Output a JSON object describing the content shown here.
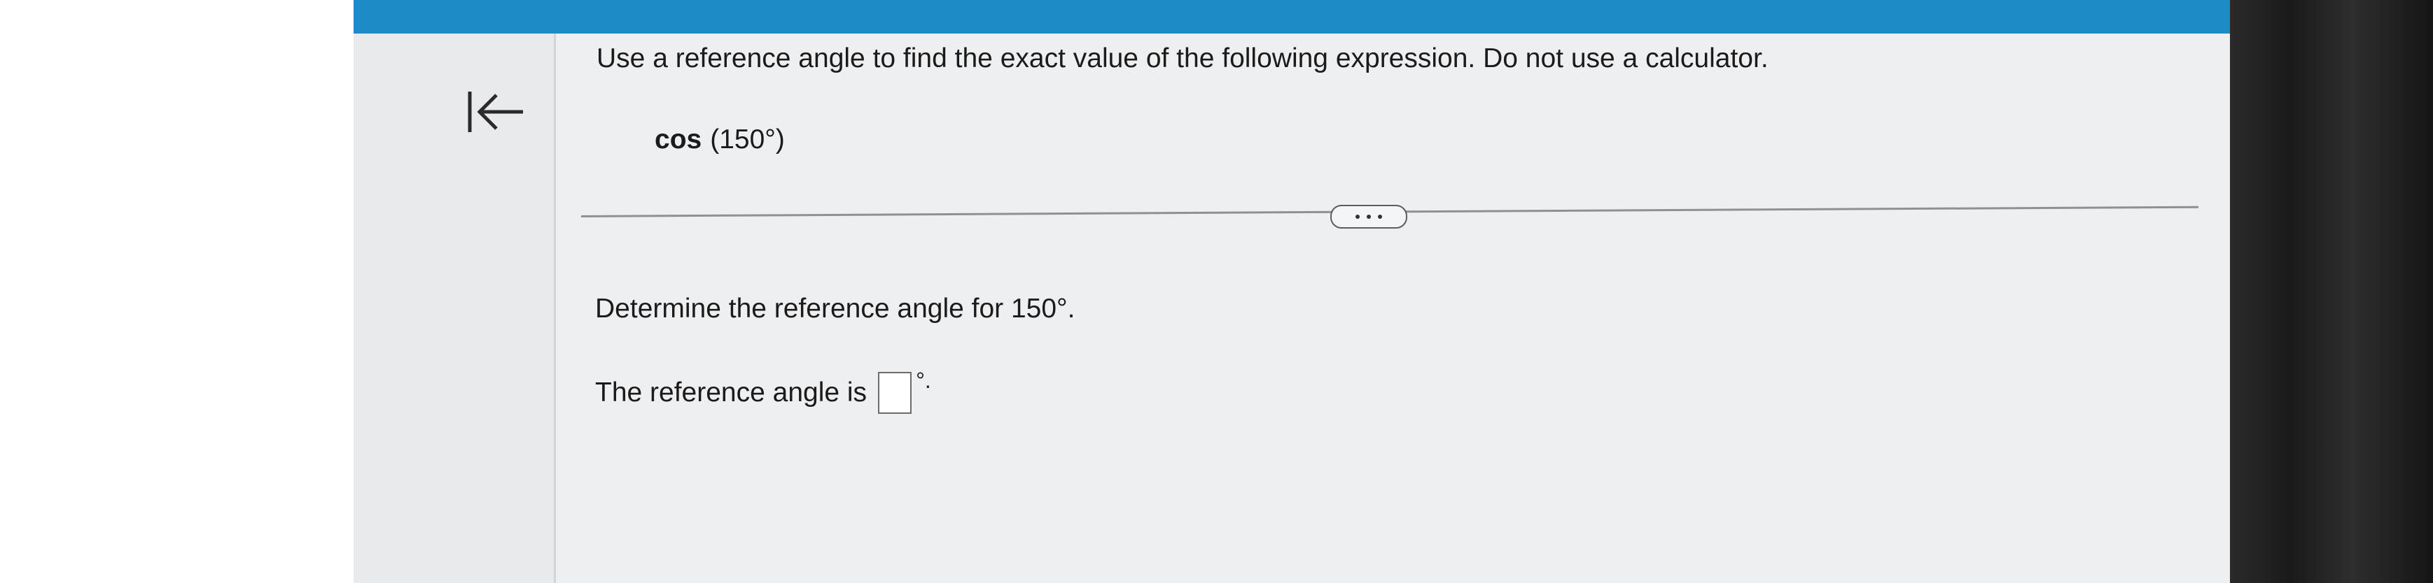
{
  "question": {
    "instruction": "Use a reference angle to find the exact value of the following expression. Do not use a calculator.",
    "expression_fn": "cos",
    "expression_arg": "(150°)"
  },
  "step": {
    "prompt": "Determine the reference angle for 150°.",
    "answer_prefix": "The reference angle is",
    "answer_suffix": "°."
  },
  "icons": {
    "back": "collapse-left-icon",
    "more": "ellipsis-icon"
  },
  "colors": {
    "topbar": "#1d8bc6",
    "background": "#eeeff1"
  }
}
